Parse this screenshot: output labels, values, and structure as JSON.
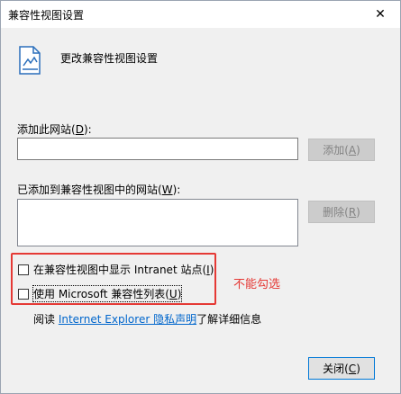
{
  "window": {
    "title": "兼容性视图设置",
    "close_glyph": "✕"
  },
  "header": {
    "title": "更改兼容性视图设置",
    "icon": "compat-view-page-icon"
  },
  "add_site": {
    "label_prefix": "添加此网站(",
    "label_key": "D",
    "label_suffix": "):",
    "input_value": "",
    "button": {
      "prefix": "添加(",
      "key": "A",
      "suffix": ")",
      "enabled": false
    }
  },
  "site_list": {
    "label_prefix": "已添加到兼容性视图中的网站(",
    "label_key": "W",
    "label_suffix": "):",
    "items": [],
    "button": {
      "prefix": "删除(",
      "key": "R",
      "suffix": ")",
      "enabled": false
    }
  },
  "options": [
    {
      "prefix": "在兼容性视图中显示 Intranet 站点(",
      "key": "I",
      "suffix": ")",
      "checked": false
    },
    {
      "prefix": "使用 Microsoft 兼容性列表(",
      "key": "U",
      "suffix": ")",
      "checked": false
    }
  ],
  "annotation": {
    "text": "不能勾选",
    "color": "#e53935"
  },
  "privacy": {
    "prefix": "阅读 ",
    "link": "Internet Explorer 隐私声明",
    "suffix": "了解详细信息"
  },
  "footer": {
    "close": {
      "prefix": "关闭(",
      "key": "C",
      "suffix": ")"
    }
  }
}
